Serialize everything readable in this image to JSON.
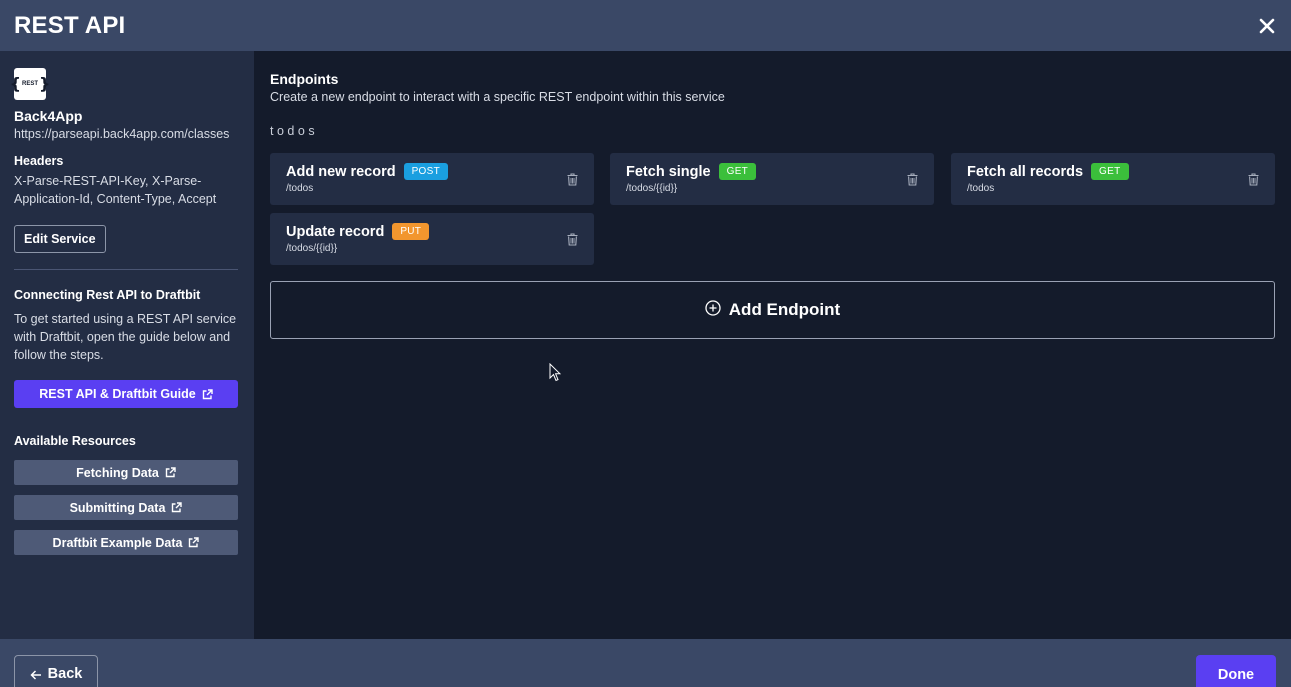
{
  "window": {
    "title": "REST API",
    "close_icon": "close-icon"
  },
  "sidebar": {
    "logo_text": "REST",
    "service_name": "Back4App",
    "service_url": "https://parseapi.back4app.com/classes",
    "headers_label": "Headers",
    "headers_value": "X-Parse-REST-API-Key, X-Parse-Application-Id, Content-Type, Accept",
    "edit_service_label": "Edit Service",
    "connect_heading": "Connecting Rest API to Draftbit",
    "connect_text": "To get started using a REST API service with Draftbit, open the guide below and follow the steps.",
    "guide_button_label": "REST API & Draftbit Guide",
    "resources_heading": "Available Resources",
    "resources": [
      {
        "label": "Fetching Data"
      },
      {
        "label": "Submitting Data"
      },
      {
        "label": "Draftbit Example Data"
      }
    ]
  },
  "main": {
    "title": "Endpoints",
    "subtitle": "Create a new endpoint to interact with a specific REST endpoint within this service",
    "resource_name": "todos",
    "endpoints": [
      {
        "name": "Add new record",
        "method": "POST",
        "path": "/todos",
        "method_color": "#1a9fe0"
      },
      {
        "name": "Fetch single",
        "method": "GET",
        "path": "/todos/{{id}}",
        "method_color": "#3bbf3b"
      },
      {
        "name": "Fetch all records",
        "method": "GET",
        "path": "/todos",
        "method_color": "#3bbf3b"
      },
      {
        "name": "Update record",
        "method": "PUT",
        "path": "/todos/{{id}}",
        "method_color": "#f2962e"
      }
    ],
    "add_endpoint_label": "Add Endpoint"
  },
  "footer": {
    "back_label": "Back",
    "done_label": "Done"
  },
  "colors": {
    "accent": "#5a3ff2",
    "header_bg": "#3a4866",
    "sidebar_bg": "#232d44",
    "main_bg": "#141b2b"
  }
}
